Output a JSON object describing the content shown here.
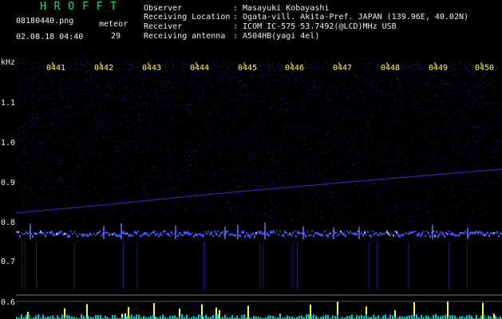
{
  "app": {
    "title": "H R O F F T"
  },
  "file": {
    "name": "08180440.png",
    "datetime": "02.08.18 04:40"
  },
  "meteor": {
    "label": "meteor",
    "count": "29"
  },
  "info": {
    "observer": {
      "label": "Observer",
      "value": ": Masayuki Kobayashi"
    },
    "location": {
      "label": "Receiving Location",
      "value": ": Ogata-vill. Akita-Pref. JAPAN (139.96E, 40.02N)"
    },
    "receiver": {
      "label": "Receiver",
      "value": ": ICOM IC-575 53.7492(@LCD)MHz USB"
    },
    "antenna": {
      "label": "Receiving antenna",
      "value": ": A504HB(yagi 4el)"
    }
  },
  "axis": {
    "unit": "kHz",
    "y_ticks": [
      "1.1",
      "1.0",
      "0.9",
      "0.8",
      "0.7",
      "0.6"
    ],
    "x_ticks": [
      "0441",
      "0442",
      "0443",
      "0444",
      "0445",
      "0446",
      "0447",
      "0448",
      "0449",
      "0450"
    ]
  },
  "colors": {
    "background": "#000000",
    "title": "#00e676",
    "tick": "#ffff33",
    "noise": "#1a1a8c",
    "signal": "#3a56ff"
  }
}
